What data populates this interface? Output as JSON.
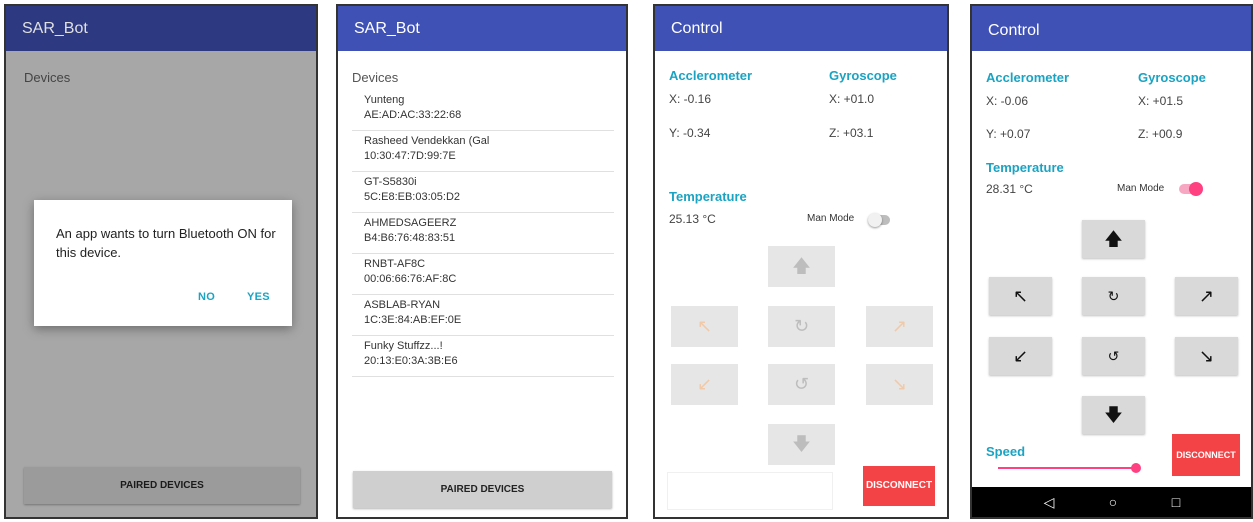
{
  "screen1": {
    "title": "SAR_Bot",
    "devices_label": "Devices",
    "dialog": {
      "message": "An app wants to turn Bluetooth ON for this device.",
      "no_label": "NO",
      "yes_label": "YES"
    },
    "paired_button": "PAIRED DEVICES"
  },
  "screen2": {
    "title": "SAR_Bot",
    "devices_label": "Devices",
    "devices": [
      {
        "name": "Yunteng",
        "address": "AE:AD:AC:33:22:68"
      },
      {
        "name": "Rasheed Vendekkan (Gal",
        "address": "10:30:47:7D:99:7E"
      },
      {
        "name": "GT-S5830i",
        "address": "5C:E8:EB:03:05:D2"
      },
      {
        "name": "AHMEDSAGEERZ",
        "address": "B4:B6:76:48:83:51"
      },
      {
        "name": "RNBT-AF8C",
        "address": "00:06:66:76:AF:8C"
      },
      {
        "name": "ASBLAB-RYAN",
        "address": "1C:3E:84:AB:EF:0E"
      },
      {
        "name": "Funky Stuffzz...!",
        "address": "20:13:E0:3A:3B:E6"
      }
    ],
    "paired_button": "PAIRED DEVICES"
  },
  "screen3": {
    "title": "Control",
    "accel_title": "Acclerometer",
    "gyro_title": "Gyroscope",
    "accel_x": "X: -0.16",
    "accel_y": "Y: -0.34",
    "gyro_x": "X: +01.0",
    "gyro_z": "Z: +03.1",
    "temp_title": "Temperature",
    "temp_value": "25.13 °C",
    "man_mode_label": "Man Mode",
    "man_mode_on": false,
    "disconnect": "DISCONNECT",
    "controls_enabled": false
  },
  "screen4": {
    "title": "Control",
    "accel_title": "Acclerometer",
    "gyro_title": "Gyroscope",
    "accel_x": "X: -0.06",
    "accel_y": "Y: +0.07",
    "gyro_x": "X: +01.5",
    "gyro_z": "Z: +00.9",
    "temp_title": "Temperature",
    "temp_value": "28.31 °C",
    "man_mode_label": "Man Mode",
    "man_mode_on": true,
    "speed_label": "Speed",
    "speed_level": 1.0,
    "disconnect": "DISCONNECT",
    "controls_enabled": true
  },
  "icons": {
    "up": "🡅",
    "down": "🡇",
    "up_left": "↖",
    "up_right": "↗",
    "down_left": "↙",
    "down_right": "↘",
    "rotate_cw": "↻",
    "rotate_ccw": "↺",
    "back": "◁",
    "home": "○",
    "recents": "□"
  },
  "colors": {
    "appbar": "#3f51b5",
    "accent": "#1aa3c2",
    "disconnect": "#f44346",
    "toggle_on": "#ff4081"
  }
}
